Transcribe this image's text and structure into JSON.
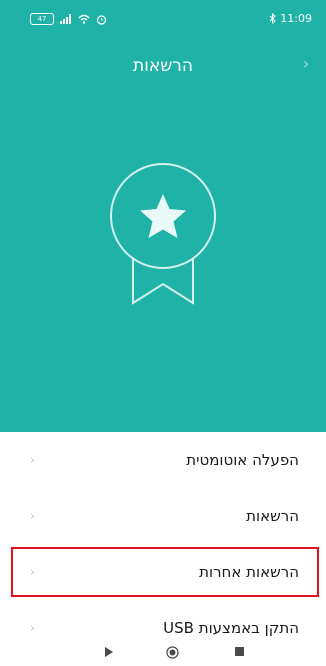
{
  "status_bar": {
    "battery": "47",
    "time": "11:09",
    "icons": [
      "battery-icon",
      "signal-icon",
      "wifi-icon",
      "alarm-icon",
      "bluetooth-icon"
    ]
  },
  "header": {
    "title": "הרשאות",
    "background_color": "#1fb3a7",
    "back_icon": "chevron-right-icon",
    "badge_icon": "star-ribbon-badge-icon"
  },
  "menu": {
    "items": [
      {
        "label": "הפעלה אוטומטית",
        "highlighted": false
      },
      {
        "label": "הרשאות",
        "highlighted": false
      },
      {
        "label": "הרשאות אחרות",
        "highlighted": true
      },
      {
        "label": "התקן באמצעות USB",
        "highlighted": false
      }
    ],
    "highlight_color": "#e0101f"
  },
  "nav_bar": {
    "buttons": [
      "back-triangle-icon",
      "home-circle-icon",
      "recents-square-icon"
    ]
  }
}
